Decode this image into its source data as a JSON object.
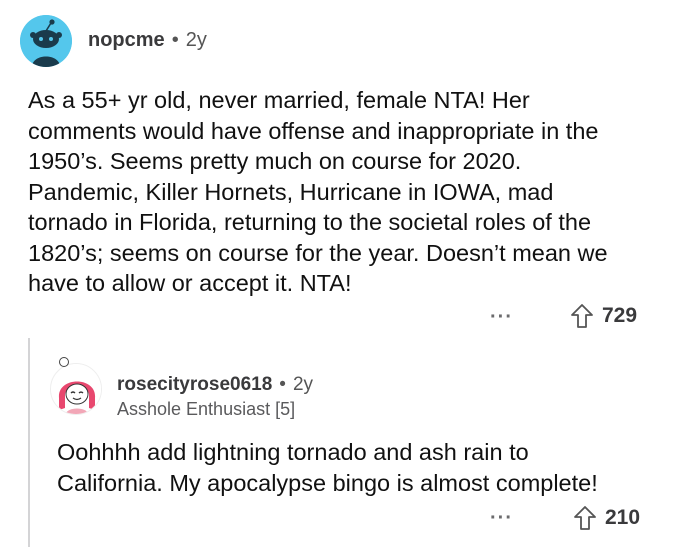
{
  "comment1": {
    "username": "nopcme",
    "separator": "•",
    "age": "2y",
    "body_lines": [
      "As a 55+ yr old, never married, female NTA!  Her",
      "comments would have offense and inappropriate in the",
      "1950’s. Seems pretty much on course for 2020.",
      "Pandemic, Killer Hornets, Hurricane in IOWA, mad",
      "tornado in Florida, returning to the societal roles of the",
      "1820’s; seems on course for the year.  Doesn’t mean we",
      "have to allow or accept it.  NTA!"
    ],
    "more_label": "···",
    "upvotes": "729",
    "avatar_icon": "snoo-avatar-icon",
    "avatar_bg": "#54c7ec"
  },
  "comment2": {
    "username": "rosecityrose0618",
    "separator": "•",
    "age": "2y",
    "flair": "Asshole Enthusiast [5]",
    "body_lines": [
      "Oohhhh add lightning tornado and ash rain to",
      "California. My apocalypse bingo is almost complete!"
    ],
    "more_label": "···",
    "upvotes": "210",
    "avatar_icon": "pink-hair-avatar-icon"
  }
}
